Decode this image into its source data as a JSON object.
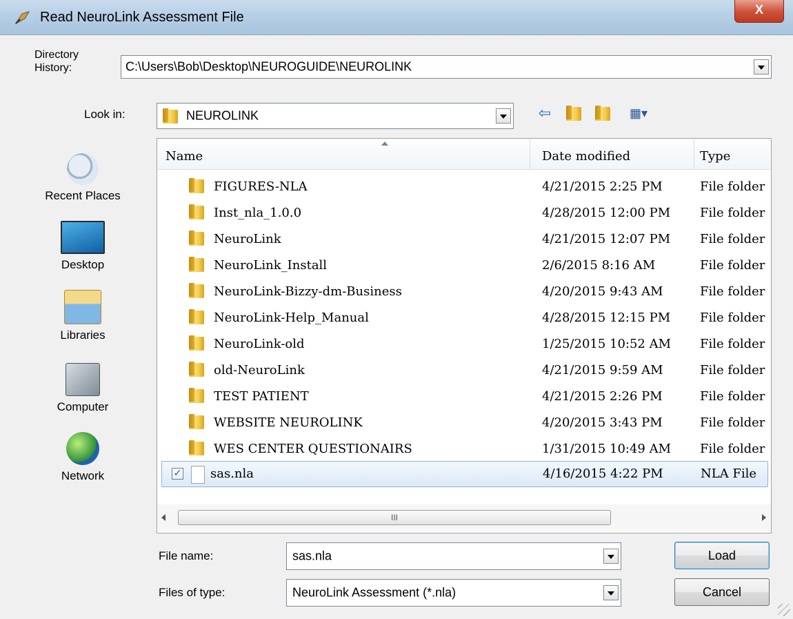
{
  "window": {
    "title": "Read NeuroLink Assessment File",
    "close_label": "X"
  },
  "directory_history": {
    "label": "Directory History:",
    "value": "C:\\Users\\Bob\\Desktop\\NEUROGUIDE\\NEUROLINK"
  },
  "look_in": {
    "label": "Look in:",
    "value": "NEUROLINK"
  },
  "toolbar": {
    "back_glyph": "⇦",
    "up_glyph": "⮤",
    "new_folder_glyph": "✶",
    "view_glyph": "▦▾"
  },
  "places": [
    {
      "label": "Recent Places",
      "icon": "recent-places-icon"
    },
    {
      "label": "Desktop",
      "icon": "desktop-icon"
    },
    {
      "label": "Libraries",
      "icon": "libraries-icon"
    },
    {
      "label": "Computer",
      "icon": "computer-icon"
    },
    {
      "label": "Network",
      "icon": "network-icon"
    }
  ],
  "columns": {
    "name": "Name",
    "date": "Date modified",
    "type": "Type"
  },
  "rows": [
    {
      "name": "FIGURES-NLA",
      "date": "4/21/2015 2:25 PM",
      "type": "File folder"
    },
    {
      "name": "Inst_nla_1.0.0",
      "date": "4/28/2015 12:00 PM",
      "type": "File folder"
    },
    {
      "name": "NeuroLink",
      "date": "4/21/2015 12:07 PM",
      "type": "File folder"
    },
    {
      "name": "NeuroLink_Install",
      "date": "2/6/2015 8:16 AM",
      "type": "File folder"
    },
    {
      "name": "NeuroLink-Bizzy-dm-Business",
      "date": "4/20/2015 9:43 AM",
      "type": "File folder"
    },
    {
      "name": "NeuroLink-Help_Manual",
      "date": "4/28/2015 12:15 PM",
      "type": "File folder"
    },
    {
      "name": "NeuroLink-old",
      "date": "1/25/2015 10:52 AM",
      "type": "File folder"
    },
    {
      "name": "old-NeuroLink",
      "date": "4/21/2015 9:59 AM",
      "type": "File folder"
    },
    {
      "name": "TEST PATIENT",
      "date": "4/21/2015 2:26 PM",
      "type": "File folder"
    },
    {
      "name": "WEBSITE NEUROLINK",
      "date": "4/20/2015 3:43 PM",
      "type": "File folder"
    },
    {
      "name": "WES CENTER QUESTIONAIRS",
      "date": "1/31/2015 10:49 AM",
      "type": "File folder"
    }
  ],
  "selected_file": {
    "name": "sas.nla",
    "date": "4/16/2015 4:22 PM",
    "type": "NLA File",
    "checked_glyph": "✓"
  },
  "scroll_thumb_glyph": "III",
  "file_name": {
    "label": "File name:",
    "value": "sas.nla"
  },
  "file_type": {
    "label": "Files of type:",
    "value": "NeuroLink Assessment (*.nla)"
  },
  "buttons": {
    "load": "Load",
    "cancel": "Cancel"
  }
}
